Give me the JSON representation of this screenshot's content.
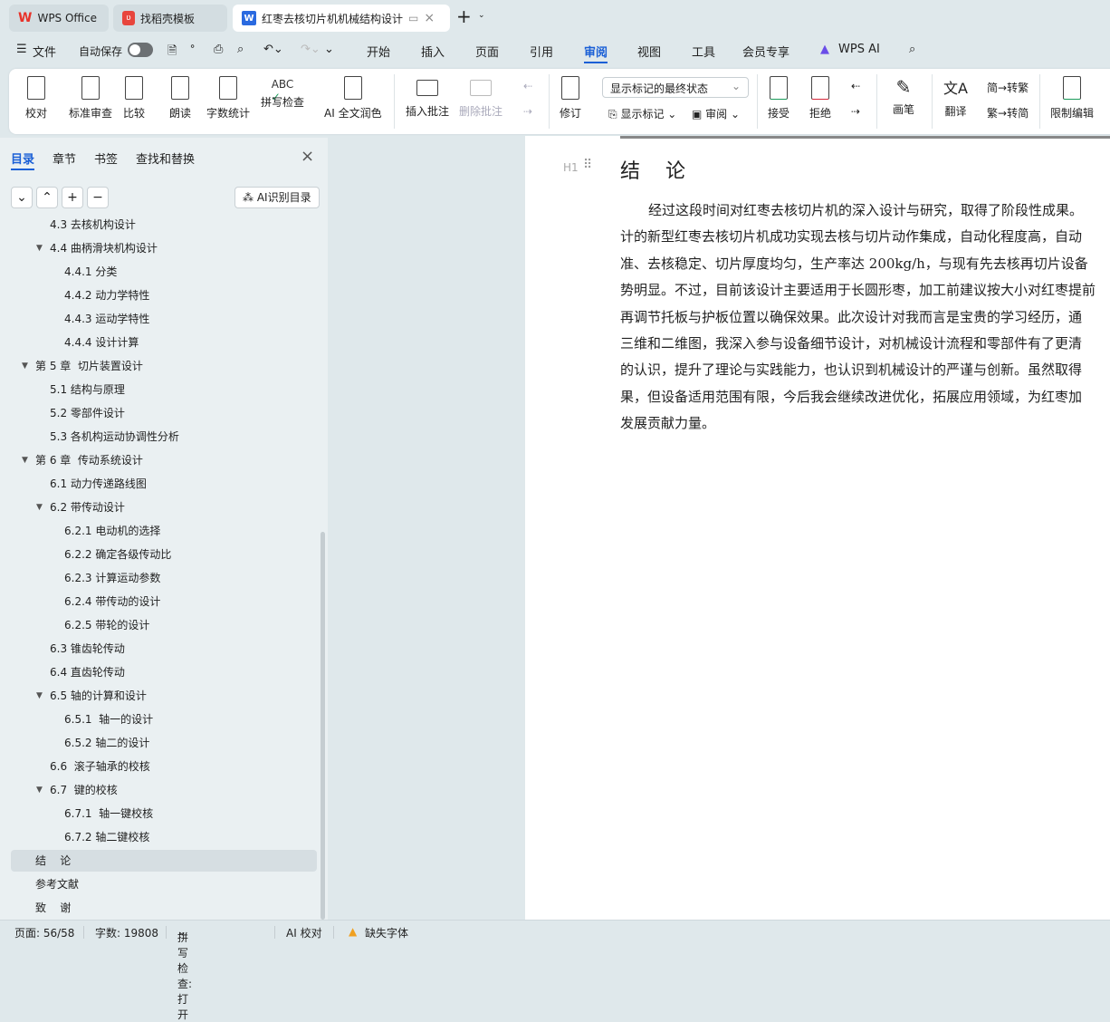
{
  "tabs": [
    {
      "label": "WPS Office",
      "icon": "wps-logo-icon"
    },
    {
      "label": "找稻壳模板",
      "icon": "docer-icon"
    },
    {
      "label": "红枣去核切片机机械结构设计",
      "icon": "word-doc-icon"
    }
  ],
  "menu": {
    "file": "文件",
    "autosave": "自动保存",
    "autosave_on": false,
    "items": [
      "开始",
      "插入",
      "页面",
      "引用",
      "审阅",
      "视图",
      "工具",
      "会员专享",
      "WPS AI"
    ],
    "active": "审阅"
  },
  "ribbon": {
    "proofread": "校对",
    "standard_review": "标准审查",
    "compare": "比较",
    "read_aloud": "朗读",
    "word_count": "字数统计",
    "spell_check": "拼写检查",
    "ai_polish": "AI 全文润色",
    "insert_comment": "插入批注",
    "delete_comment": "删除批注",
    "markup_state": "显示标记的最终状态",
    "track_changes": "修订",
    "show_markup": "显示标记",
    "review_pane": "审阅",
    "accept": "接受",
    "reject": "拒绝",
    "pen": "画笔",
    "translate": "翻译",
    "to_traditional": "转繁",
    "to_simplified": "转简",
    "restrict_edit": "限制编辑"
  },
  "nav": {
    "tabs": [
      "目录",
      "章节",
      "书签",
      "查找和替换"
    ],
    "active": "目录",
    "ai_toc": "AI识别目录",
    "items": [
      {
        "label": "4.3 去核机构设计",
        "level": 2
      },
      {
        "label": "4.4 曲柄滑块机构设计",
        "level": 2,
        "expanded": true
      },
      {
        "label": "4.4.1 分类",
        "level": 3
      },
      {
        "label": "4.4.2 动力学特性",
        "level": 3
      },
      {
        "label": "4.4.3 运动学特性",
        "level": 3
      },
      {
        "label": "4.4.4 设计计算",
        "level": 3
      },
      {
        "label": "第 5 章  切片装置设计",
        "level": 1,
        "expanded": true
      },
      {
        "label": "5.1 结构与原理",
        "level": 2
      },
      {
        "label": "5.2 零部件设计",
        "level": 2
      },
      {
        "label": "5.3 各机构运动协调性分析",
        "level": 2
      },
      {
        "label": "第 6 章  传动系统设计",
        "level": 1,
        "expanded": true
      },
      {
        "label": "6.1 动力传递路线图",
        "level": 2
      },
      {
        "label": "6.2 带传动设计",
        "level": 2,
        "expanded": true
      },
      {
        "label": "6.2.1 电动机的选择",
        "level": 3
      },
      {
        "label": "6.2.2 确定各级传动比",
        "level": 3
      },
      {
        "label": "6.2.3 计算运动参数",
        "level": 3
      },
      {
        "label": "6.2.4 带传动的设计",
        "level": 3
      },
      {
        "label": "6.2.5 带轮的设计",
        "level": 3
      },
      {
        "label": "6.3 锥齿轮传动",
        "level": 2
      },
      {
        "label": "6.4 直齿轮传动",
        "level": 2
      },
      {
        "label": "6.5 轴的计算和设计",
        "level": 2,
        "expanded": true
      },
      {
        "label": "6.5.1  轴一的设计",
        "level": 3
      },
      {
        "label": "6.5.2 轴二的设计",
        "level": 3
      },
      {
        "label": "6.6  滚子轴承的校核",
        "level": 2
      },
      {
        "label": "6.7  键的校核",
        "level": 2,
        "expanded": true
      },
      {
        "label": "6.7.1  轴一键校核",
        "level": 3
      },
      {
        "label": "6.7.2 轴二键校核",
        "level": 3
      },
      {
        "label": "结    论",
        "level": 1,
        "selected": true
      },
      {
        "label": "参考文献",
        "level": 1
      },
      {
        "label": "致    谢",
        "level": 1
      }
    ]
  },
  "document": {
    "heading": "结    论",
    "heading_tag": "H1",
    "lines": [
      "经过这段时间对红枣去核切片机的深入设计与研究，取得了阶段性成果。",
      "计的新型红枣去核切片机成功实现去核与切片动作集成，自动化程度高，自动",
      "准、去核稳定、切片厚度均匀，生产率达 200kg/h，与现有先去核再切片设备",
      "势明显。不过，目前该设计主要适用于长圆形枣，加工前建议按大小对红枣提前",
      "再调节托板与护板位置以确保效果。此次设计对我而言是宝贵的学习经历，通",
      "三维和二维图，我深入参与设备细节设计，对机械设计流程和零部件有了更清",
      "的认识，提升了理论与实践能力，也认识到机械设计的严谨与创新。虽然取得",
      "果，但设备适用范围有限，今后我会继续改进优化，拓展应用领域，为红枣加",
      "发展贡献力量。"
    ]
  },
  "status": {
    "page": "页面: 56/58",
    "words": "字数: 19808",
    "spell": "拼写检查: 打开",
    "ai_check": "AI 校对",
    "missing_font": "缺失字体"
  },
  "colors": {
    "accent": "#1a5fd6",
    "wps_red": "#e8332a"
  }
}
